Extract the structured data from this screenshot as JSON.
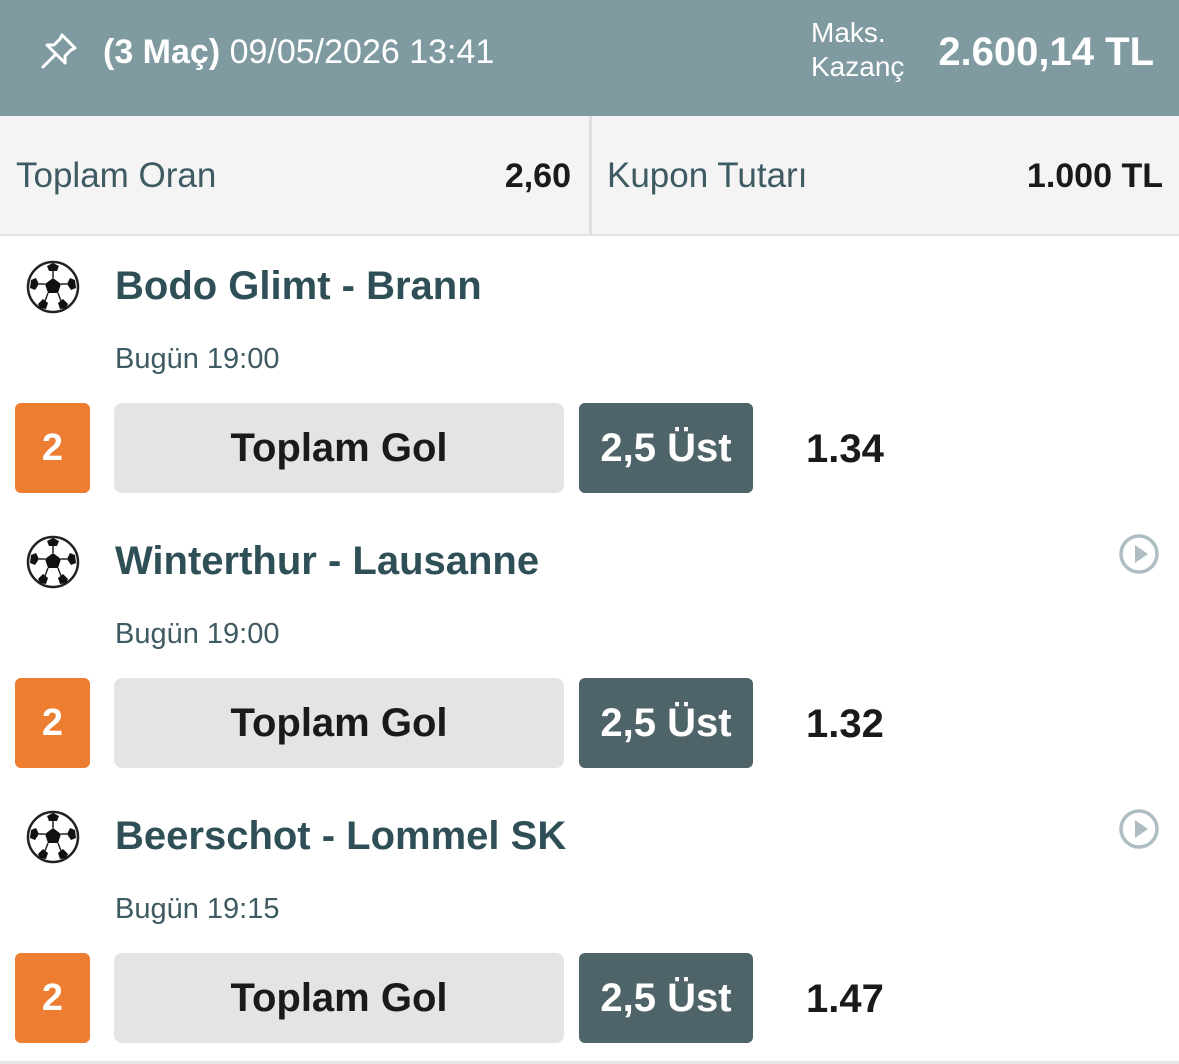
{
  "header": {
    "match_count": "(3 Maç)",
    "datetime": "09/05/2026 13:41",
    "max_label_line1": "Maks.",
    "max_label_line2": "Kazanç",
    "max_amount": "2.600,14 TL",
    "background_color": "#7f9aa0",
    "pin_icon": "pin-icon"
  },
  "summary": {
    "total_odds_label": "Toplam Oran",
    "total_odds_value": "2,60",
    "coupon_amount_label": "Kupon Tutarı",
    "coupon_amount_value": "1.000 TL"
  },
  "matches": [
    {
      "teams": "Bodo Glimt - Brann",
      "time": "Bugün 19:00",
      "pick": "2",
      "market": "Toplam Gol",
      "selection": "2,5 Üst",
      "odds": "1.34",
      "has_play_icon": false
    },
    {
      "teams": "Winterthur - Lausanne",
      "time": "Bugün 19:00",
      "pick": "2",
      "market": "Toplam Gol",
      "selection": "2,5 Üst",
      "odds": "1.32",
      "has_play_icon": true
    },
    {
      "teams": "Beerschot - Lommel SK",
      "time": "Bugün 19:15",
      "pick": "2",
      "market": "Toplam Gol",
      "selection": "2,5 Üst",
      "odds": "1.47",
      "has_play_icon": true
    }
  ],
  "colors": {
    "pick_badge": "#ed7d31",
    "selection_bg": "#4e6469",
    "team_text": "#2f4f57"
  },
  "icons": {
    "sport": "soccer-ball-icon",
    "live": "play-circle-icon"
  }
}
